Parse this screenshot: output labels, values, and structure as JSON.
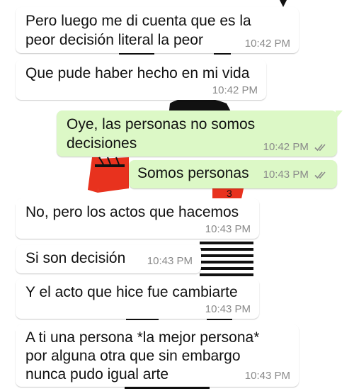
{
  "messages": [
    {
      "direction": "incoming",
      "text": "Pero luego me di cuenta que es la\npeor decisión literal la peor",
      "time": "10:42 PM"
    },
    {
      "direction": "incoming",
      "text": "Que pude haber hecho en mi vida",
      "time": "10:42 PM"
    },
    {
      "direction": "outgoing",
      "text": "Oye, las personas no somos\ndecisiones",
      "time": "10:42 PM",
      "status": "read"
    },
    {
      "direction": "outgoing",
      "text": "Somos personas",
      "time": "10:43 PM",
      "status": "read"
    },
    {
      "direction": "incoming",
      "text": "No, pero los actos que hacemos",
      "time": "10:43 PM"
    },
    {
      "direction": "incoming",
      "text": "Si son decisión",
      "time": "10:43 PM"
    },
    {
      "direction": "incoming",
      "text": "Y el acto que hice fue cambiarte",
      "time": "10:43 PM"
    },
    {
      "direction": "incoming",
      "text": "A ti una persona *la mejor persona*\npor alguna otra que sin embargo\nnunca pudo igual arte",
      "time": "10:43 PM"
    }
  ],
  "colors": {
    "incoming_bubble": "#ffffff",
    "outgoing_bubble": "#dcf8c6",
    "timestamp": "#8a8a8a",
    "read_ticks": "#8a8a8a",
    "wallpaper_red": "#e8321e",
    "wallpaper_black": "#111111"
  },
  "icons": {
    "read_receipt": "double-check-icon"
  }
}
